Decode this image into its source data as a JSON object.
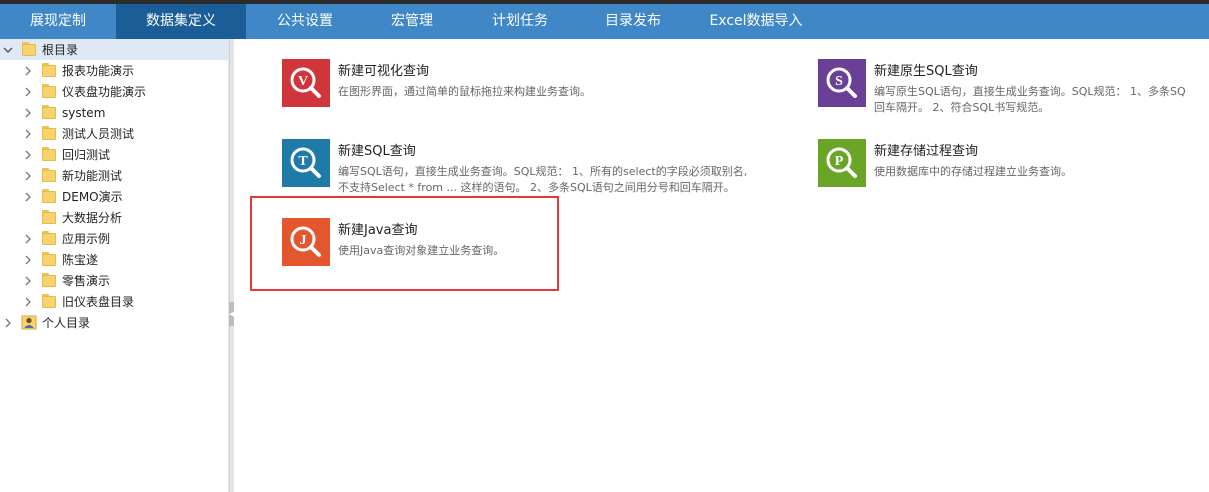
{
  "nav": {
    "tabs": [
      {
        "label": "展现定制"
      },
      {
        "label": "数据集定义"
      },
      {
        "label": "公共设置"
      },
      {
        "label": "宏管理"
      },
      {
        "label": "计划任务"
      },
      {
        "label": "目录发布"
      },
      {
        "label": "Excel数据导入"
      }
    ],
    "active_index": 1,
    "colors": {
      "bar": "#3f87c6",
      "active": "#1b5d96"
    }
  },
  "tree": {
    "root": {
      "label": "根目录",
      "icon": "folder-icon",
      "expanded": true
    },
    "items": [
      {
        "label": "报表功能演示",
        "expandable": true
      },
      {
        "label": "仪表盘功能演示",
        "expandable": true
      },
      {
        "label": "system",
        "expandable": true
      },
      {
        "label": "测试人员测试",
        "expandable": true
      },
      {
        "label": "回归测试",
        "expandable": true
      },
      {
        "label": "新功能测试",
        "expandable": true
      },
      {
        "label": "DEMO演示",
        "expandable": true
      },
      {
        "label": "大数据分析",
        "expandable": false
      },
      {
        "label": "应用示例",
        "expandable": true
      },
      {
        "label": "陈宝遂",
        "expandable": true
      },
      {
        "label": "零售演示",
        "expandable": true
      },
      {
        "label": "旧仪表盘目录",
        "expandable": true
      }
    ],
    "personal": {
      "label": "个人目录",
      "icon": "user-icon"
    }
  },
  "cards": [
    {
      "id": "visual",
      "letter": "V",
      "color": "#d0353b",
      "title": "新建可视化查询",
      "desc": [
        "在图形界面，通过简单的鼠标拖拉来构建业务查询。"
      ]
    },
    {
      "id": "native-sql",
      "letter": "S",
      "color": "#6a3f96",
      "title": "新建原生SQL查询",
      "desc": [
        "编写原生SQL语句，直接生成业务查询。SQL规范： 1、多条SQ",
        "回车隔开。 2、符合SQL书写规范。"
      ]
    },
    {
      "id": "sql",
      "letter": "T",
      "color": "#1e7ba8",
      "title": "新建SQL查询",
      "desc": [
        "编写SQL语句，直接生成业务查询。SQL规范： 1、所有的select的字段必须取别名,",
        "不支持Select * from ... 这样的语句。 2、多条SQL语句之间用分号和回车隔开。"
      ]
    },
    {
      "id": "proc",
      "letter": "P",
      "color": "#6aa528",
      "title": "新建存储过程查询",
      "desc": [
        "使用数据库中的存储过程建立业务查询。"
      ]
    },
    {
      "id": "java",
      "letter": "J",
      "color": "#e4572e",
      "title": "新建Java查询",
      "desc": [
        "使用Java查询对象建立业务查询。"
      ],
      "highlighted": true
    }
  ]
}
